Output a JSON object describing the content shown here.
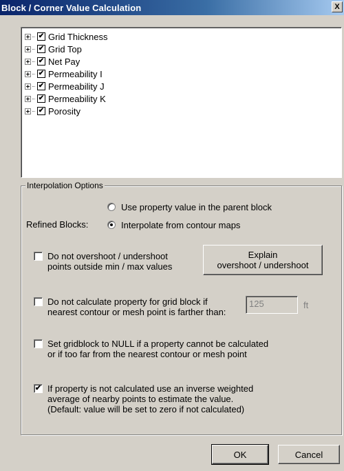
{
  "window": {
    "title": "Block / Corner Value Calculation",
    "close_glyph": "X"
  },
  "tree": {
    "items": [
      {
        "label": "Grid Thickness",
        "checked": true
      },
      {
        "label": "Grid Top",
        "checked": true
      },
      {
        "label": "Net Pay",
        "checked": true
      },
      {
        "label": "Permeability I",
        "checked": true
      },
      {
        "label": "Permeability J",
        "checked": true
      },
      {
        "label": "Permeability K",
        "checked": true
      },
      {
        "label": "Porosity",
        "checked": true
      }
    ],
    "check_glyph": "✔"
  },
  "interpolation": {
    "group_title": "Interpolation Options",
    "refined_blocks_label": "Refined Blocks:",
    "radio_parent": "Use property value in the parent block",
    "radio_contour": "Interpolate from contour maps",
    "selected_radio": "contour",
    "overshoot": {
      "line1": "Do not overshoot / undershoot",
      "line2": "points outside min / max values",
      "checked": false
    },
    "explain_button": {
      "line1": "Explain",
      "line2": "overshoot / undershoot"
    },
    "grid_block": {
      "line1": "Do not calculate property for grid block if",
      "line2": "nearest contour or mesh point is farther than:",
      "checked": false,
      "distance_value": "125",
      "unit": "ft"
    },
    "null_option": {
      "line1": "Set gridblock to NULL if a property cannot be calculated",
      "line2": "or if too far from the nearest contour or mesh point",
      "checked": false
    },
    "inverse_weighted": {
      "line1": "If property is not calculated use an inverse weighted",
      "line2": "average of nearby points to estimate the value.",
      "line3": "(Default: value will be set to zero if not calculated)",
      "checked": true
    }
  },
  "buttons": {
    "ok": "OK",
    "cancel": "Cancel"
  }
}
